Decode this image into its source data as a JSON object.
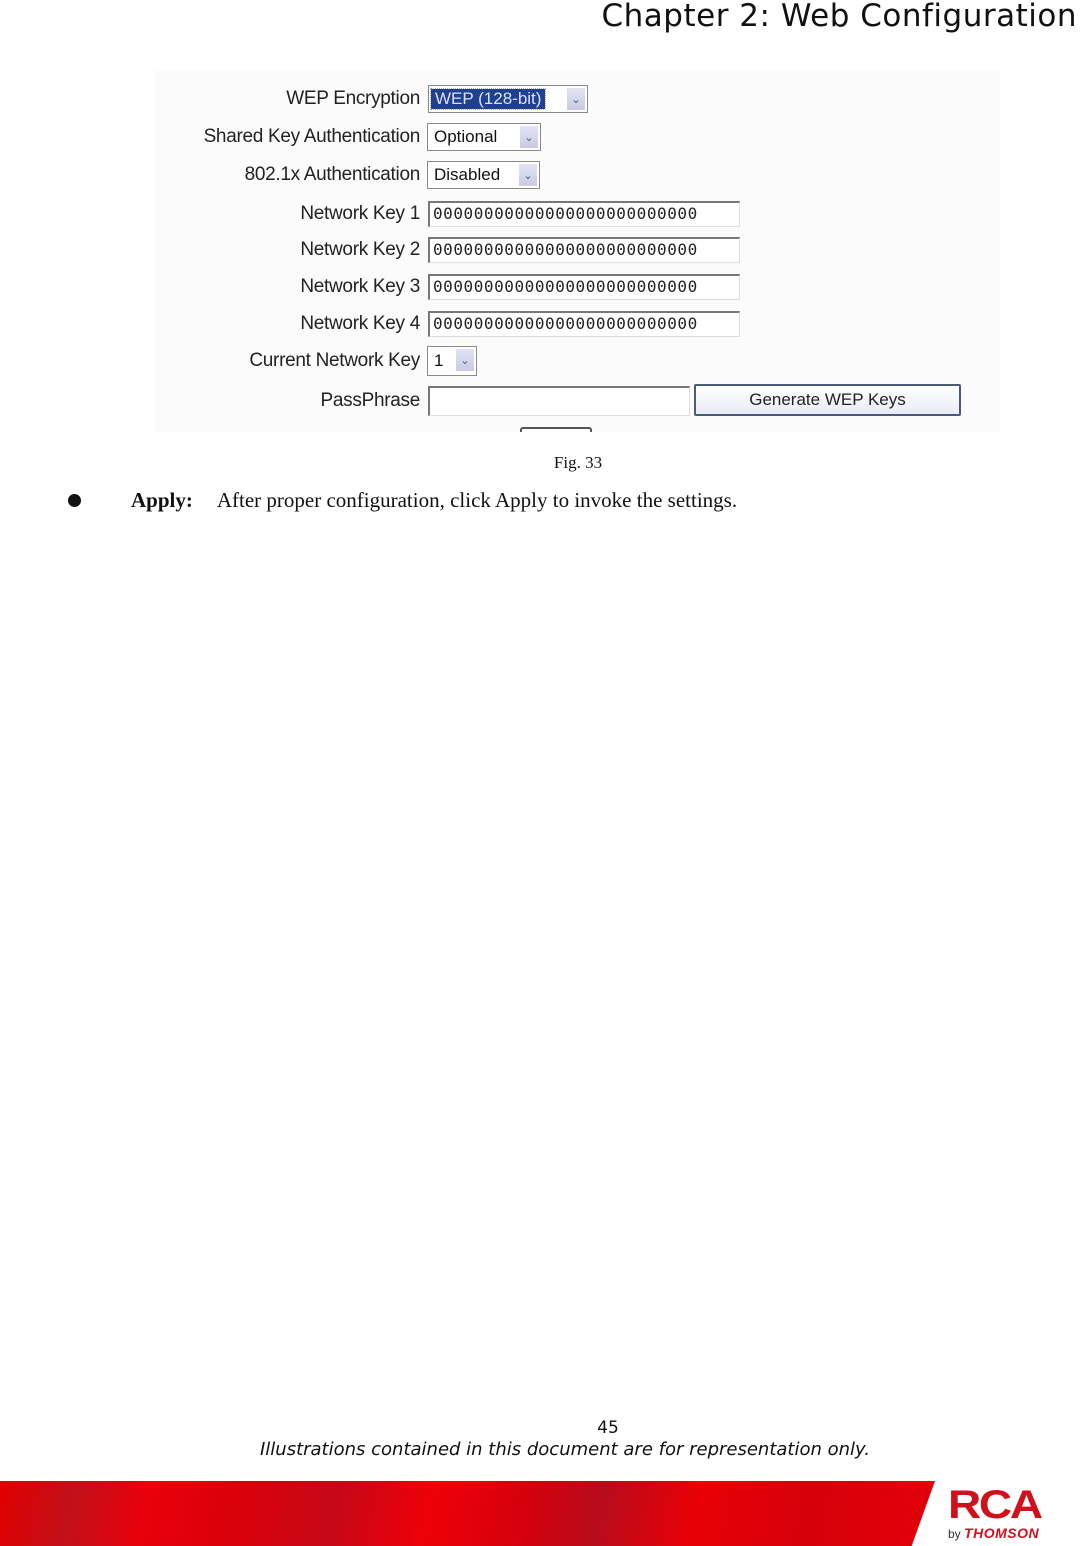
{
  "header": {
    "chapter_title": "Chapter 2: Web Configuration"
  },
  "figure": {
    "fields": {
      "wep_encryption": {
        "label": "WEP Encryption",
        "value": "WEP (128-bit)"
      },
      "shared_key_auth": {
        "label": "Shared Key Authentication",
        "value": "Optional"
      },
      "dot1x_auth": {
        "label": "802.1x Authentication",
        "value": "Disabled"
      },
      "network_keys": [
        {
          "label": "Network Key 1",
          "value": "00000000000000000000000000"
        },
        {
          "label": "Network Key 2",
          "value": "00000000000000000000000000"
        },
        {
          "label": "Network Key 3",
          "value": "00000000000000000000000000"
        },
        {
          "label": "Network Key 4",
          "value": "00000000000000000000000000"
        }
      ],
      "current_network_key": {
        "label": "Current Network Key",
        "value": "1"
      },
      "passphrase": {
        "label": "PassPhrase",
        "value": ""
      }
    },
    "generate_button_label": "Generate WEP Keys",
    "caption": "Fig. 33"
  },
  "body": {
    "bullet_term": "Apply:",
    "bullet_text": "After proper configuration, click Apply to invoke the settings."
  },
  "footer": {
    "page_number": "45",
    "disclaimer": "Illustrations contained in this document are for representation only.",
    "logo_brand": "RCA",
    "logo_by": "by",
    "logo_company": "THOMSON",
    "brand_color": "#d0101a"
  }
}
